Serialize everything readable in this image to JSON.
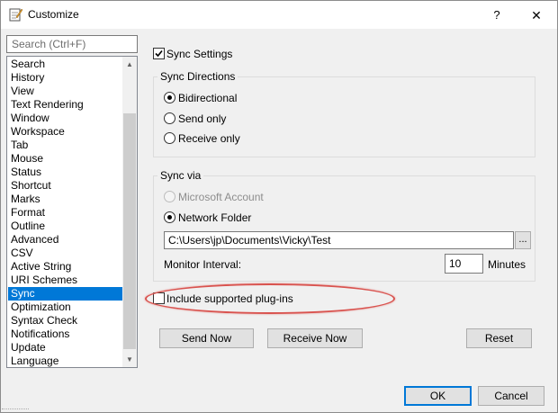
{
  "window": {
    "title": "Customize",
    "help": "?",
    "close": "✕"
  },
  "search": {
    "placeholder": "Search (Ctrl+F)"
  },
  "nav": {
    "items": [
      "Search",
      "History",
      "View",
      "Text Rendering",
      "Window",
      "Workspace",
      "Tab",
      "Mouse",
      "Status",
      "Shortcut",
      "Marks",
      "Format",
      "Outline",
      "Advanced",
      "CSV",
      "Active String",
      "URI Schemes",
      "Sync",
      "Optimization",
      "Syntax Check",
      "Notifications",
      "Update",
      "Language"
    ],
    "selected": "Sync"
  },
  "sync": {
    "sync_settings_label": "Sync Settings",
    "sync_settings_checked": true,
    "directions": {
      "title": "Sync Directions",
      "options": [
        "Bidirectional",
        "Send only",
        "Receive only"
      ],
      "selected": "Bidirectional"
    },
    "via": {
      "title": "Sync via",
      "microsoft_account": "Microsoft Account",
      "network_folder": "Network Folder",
      "selected": "Network Folder",
      "path": "C:\\Users\\jp\\Documents\\Vicky\\Test",
      "browse": "...",
      "monitor_interval_label": "Monitor Interval:",
      "monitor_interval_value": "10",
      "minutes": "Minutes"
    },
    "include_plugins_label": "Include supported plug-ins",
    "include_plugins_checked": false
  },
  "buttons": {
    "send_now": "Send Now",
    "receive_now": "Receive Now",
    "reset": "Reset",
    "ok": "OK",
    "cancel": "Cancel"
  },
  "colors": {
    "selection": "#0078d7",
    "annotation": "#d9534f"
  }
}
